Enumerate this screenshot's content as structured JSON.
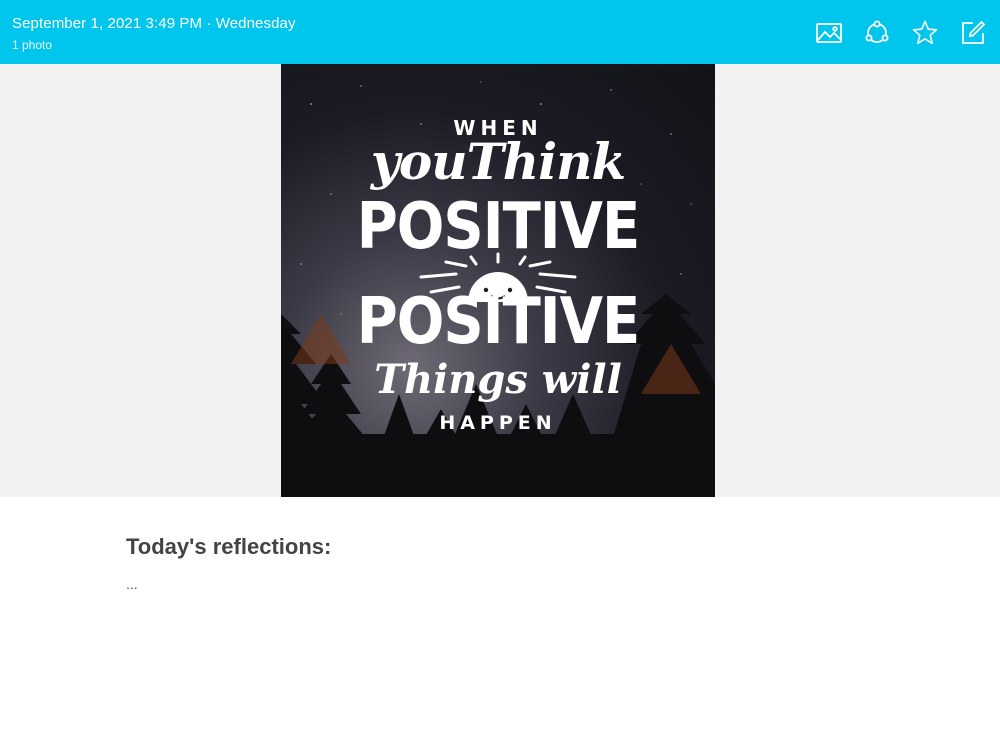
{
  "header": {
    "date": "September 1, 2021 3:49 PM · Wednesday",
    "photo_count": "1 photo",
    "icons": [
      "image-icon",
      "share-icon",
      "star-icon",
      "edit-icon"
    ]
  },
  "photo": {
    "lines": [
      "WHEN",
      "youThink",
      "POSITIVE",
      "POSITIVE",
      "Things will",
      "HAPPEN"
    ]
  },
  "entry": {
    "heading": "Today's reflections:",
    "body": "..."
  },
  "colors": {
    "header_bg": "#00c5ec",
    "header_text": "#ffffff",
    "heading_text": "#444444"
  }
}
